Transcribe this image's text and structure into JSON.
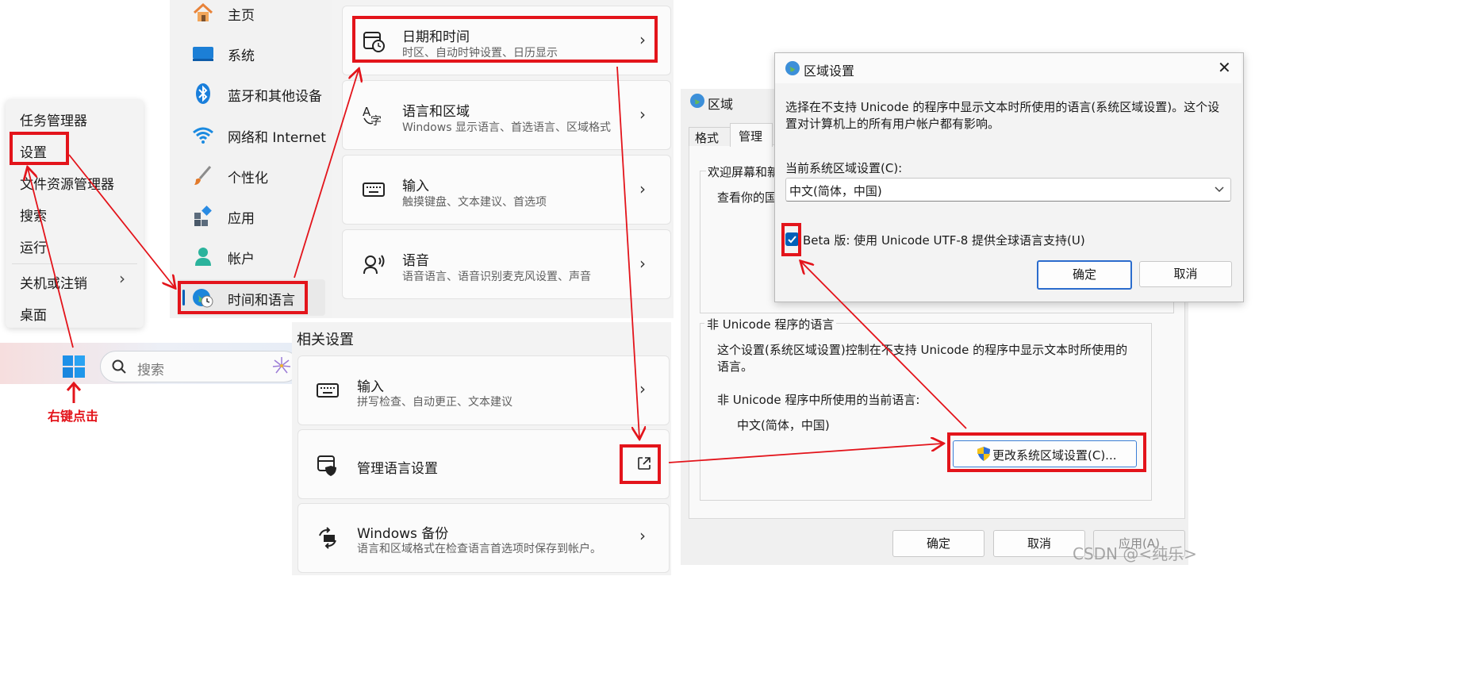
{
  "context_menu": {
    "items": [
      "任务管理器",
      "设置",
      "文件资源管理器",
      "搜索",
      "运行",
      "关机或注销",
      "桌面"
    ],
    "submenu_chevron": "›"
  },
  "taskbar": {
    "search_placeholder": "搜索",
    "annotation": "右键点击"
  },
  "settings_nav": {
    "items": [
      {
        "label": "主页",
        "icon": "home-icon"
      },
      {
        "label": "系统",
        "icon": "monitor-icon"
      },
      {
        "label": "蓝牙和其他设备",
        "icon": "bluetooth-icon"
      },
      {
        "label": "网络和 Internet",
        "icon": "wifi-icon"
      },
      {
        "label": "个性化",
        "icon": "brush-icon"
      },
      {
        "label": "应用",
        "icon": "apps-icon"
      },
      {
        "label": "帐户",
        "icon": "account-icon"
      },
      {
        "label": "时间和语言",
        "icon": "globe-clock-icon"
      }
    ],
    "selected": "时间和语言"
  },
  "time_language_cards": [
    {
      "title": "日期和时间",
      "subtitle": "时区、自动时钟设置、日历显示",
      "icon": "calendar-clock-icon"
    },
    {
      "title": "语言和区域",
      "subtitle": "Windows 显示语言、首选语言、区域格式",
      "icon": "language-icon"
    },
    {
      "title": "输入",
      "subtitle": "触摸键盘、文本建议、首选项",
      "icon": "keyboard-icon"
    },
    {
      "title": "语音",
      "subtitle": "语音语言、语音识别麦克风设置、声音",
      "icon": "speech-icon"
    }
  ],
  "related_settings": {
    "heading": "相关设置",
    "cards": [
      {
        "title": "输入",
        "subtitle": "拼写检查、自动更正、文本建议",
        "icon": "keyboard-icon",
        "action": "chevron"
      },
      {
        "title": "管理语言设置",
        "subtitle": "",
        "icon": "shield-page-icon",
        "action": "external-link"
      },
      {
        "title": "Windows 备份",
        "subtitle": "语言和区域格式在检查语言首选项时保存到帐户。",
        "icon": "backup-sync-icon",
        "action": "chevron"
      }
    ]
  },
  "region_dialog": {
    "title": "区域",
    "tabs": [
      "格式",
      "管理"
    ],
    "welcome_text": "欢迎屏幕和新",
    "view_text": "查看你的国",
    "nonunicode_group": "非 Unicode 程序的语言",
    "nonunicode_desc_line1": "这个设置(系统区域设置)控制在不支持 Unicode 的程序中显示文本时所使用的",
    "nonunicode_desc_line2": "语言。",
    "current_label": "非 Unicode 程序中所使用的当前语言:",
    "current_value": "中文(简体，中国)",
    "change_button": "更改系统区域设置(C)...",
    "ok": "确定",
    "cancel": "取消",
    "apply": "应用(A)"
  },
  "region_settings_dialog": {
    "title": "区域设置",
    "desc_line1": "选择在不支持 Unicode 的程序中显示文本时所使用的语言(系统区域设置)。这个设",
    "desc_line2": "置对计算机上的所有用户帐户都有影响。",
    "current_label": "当前系统区域设置(C):",
    "current_value": "中文(简体，中国)",
    "beta_label": "Beta 版: 使用 Unicode UTF-8 提供全球语言支持(U)",
    "beta_checked": true,
    "ok": "确定",
    "cancel": "取消",
    "close": "✕"
  },
  "watermark": "CSDN @<纯乐>",
  "colors": {
    "annotation_red": "#e3141b",
    "accent_blue": "#005fb8",
    "nav_indicator": "#005fb8"
  }
}
